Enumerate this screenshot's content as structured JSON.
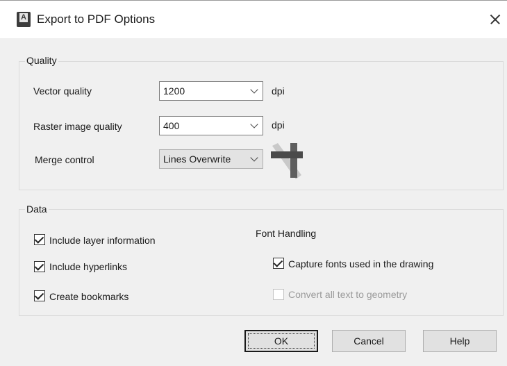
{
  "window": {
    "title": "Export to PDF Options",
    "icon": "autocad-icon"
  },
  "quality": {
    "legend": "Quality",
    "vector": {
      "label": "Vector quality",
      "value": "1200",
      "unit": "dpi"
    },
    "raster": {
      "label": "Raster image quality",
      "value": "400",
      "unit": "dpi"
    },
    "merge": {
      "label": "Merge control",
      "value": "Lines Overwrite"
    }
  },
  "data": {
    "legend": "Data",
    "include_layer": {
      "label": "Include layer information",
      "checked": true
    },
    "include_hyperlinks": {
      "label": "Include hyperlinks",
      "checked": true
    },
    "create_bookmarks": {
      "label": "Create bookmarks",
      "checked": true
    },
    "font_handling": {
      "title": "Font Handling",
      "capture_fonts": {
        "label": "Capture fonts used in the drawing",
        "checked": true
      },
      "convert_text": {
        "label": "Convert all text to geometry",
        "checked": false,
        "disabled": true
      }
    }
  },
  "buttons": {
    "ok": "OK",
    "cancel": "Cancel",
    "help": "Help"
  }
}
